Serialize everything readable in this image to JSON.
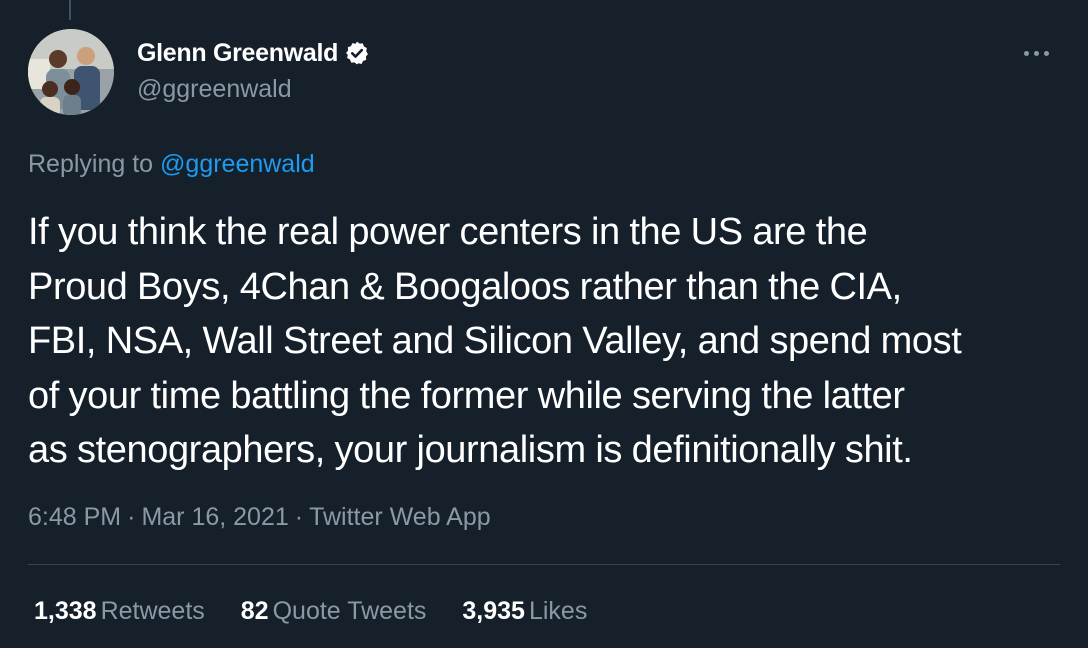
{
  "author": {
    "name": "Glenn Greenwald",
    "handle": "@ggreenwald",
    "verified": true
  },
  "reply": {
    "prefix": "Replying to ",
    "handle": "@ggreenwald"
  },
  "tweet": {
    "lines": [
      "If you think the real power centers in the US are the",
      "Proud Boys, 4Chan & Boogaloos rather than the CIA,",
      "FBI, NSA, Wall Street and Silicon Valley, and spend most",
      "of your time battling the former while serving the latter",
      "as stenographers, your journalism is definitionally shit."
    ]
  },
  "meta": {
    "time": "6:48 PM",
    "date": "Mar 16, 2021",
    "source": "Twitter Web App",
    "separator": "·"
  },
  "stats": {
    "retweets": {
      "count": "1,338",
      "label": "Retweets"
    },
    "quotes": {
      "count": "82",
      "label": "Quote Tweets"
    },
    "likes": {
      "count": "3,935",
      "label": "Likes"
    }
  },
  "colors": {
    "background": "#15202b",
    "text": "#ffffff",
    "secondary": "#8b98a5",
    "link": "#1d9bf0",
    "divider": "#38444d"
  },
  "icons": {
    "verified": "verified-badge-icon",
    "more": "more-horizontal-icon"
  }
}
